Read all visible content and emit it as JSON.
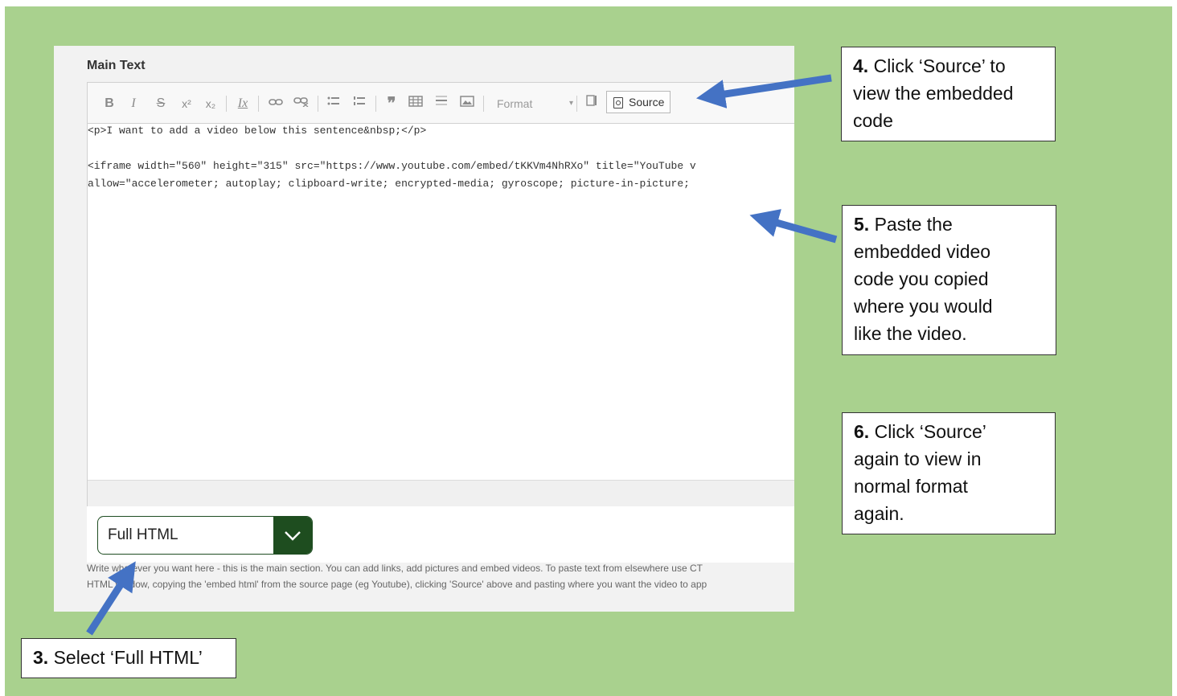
{
  "editor": {
    "field_label": "Main Text",
    "toolbar": {
      "bold": "B",
      "italic": "I",
      "strike": "S",
      "superscript": "x²",
      "subscript": "x₂",
      "remove_format": "Ix",
      "format_dropdown": "Format",
      "source_label": "Source"
    },
    "code_lines": [
      "<p>I want to add a video below this sentence&nbsp;</p>",
      "",
      "<iframe width=\"560\" height=\"315\" src=\"https://www.youtube.com/embed/tKKVm4NhRXo\" title=\"YouTube v",
      "allow=\"accelerometer; autoplay; clipboard-write; encrypted-media; gyroscope; picture-in-picture;"
    ],
    "text_format": {
      "selected": "Full HTML"
    },
    "help_text": [
      "Write whatever you want here - this is the main section. You can add links, add pictures and embed videos. To paste text from elsewhere use CT",
      "HTML window, copying the 'embed html' from the source page (eg Youtube), clicking 'Source' above and pasting where you want the video to app"
    ]
  },
  "callouts": {
    "step3": {
      "num": "3.",
      "text": " Select ‘Full HTML’"
    },
    "step4": {
      "num": "4.",
      "line1": " Click ‘Source’ to",
      "line2": "view the embedded",
      "line3": "code"
    },
    "step5": {
      "num": "5.",
      "line1": " Paste the",
      "line2": "embedded video",
      "line3": "code you copied",
      "line4": "where you would",
      "line5": "like the video."
    },
    "step6": {
      "num": "6.",
      "line1": " Click ‘Source’",
      "line2": "again to view in",
      "line3": "normal format",
      "line4": "again."
    }
  },
  "colors": {
    "slide_background": "#a9d18e",
    "arrow": "#4472c4",
    "select_button": "#1e4d1f"
  }
}
